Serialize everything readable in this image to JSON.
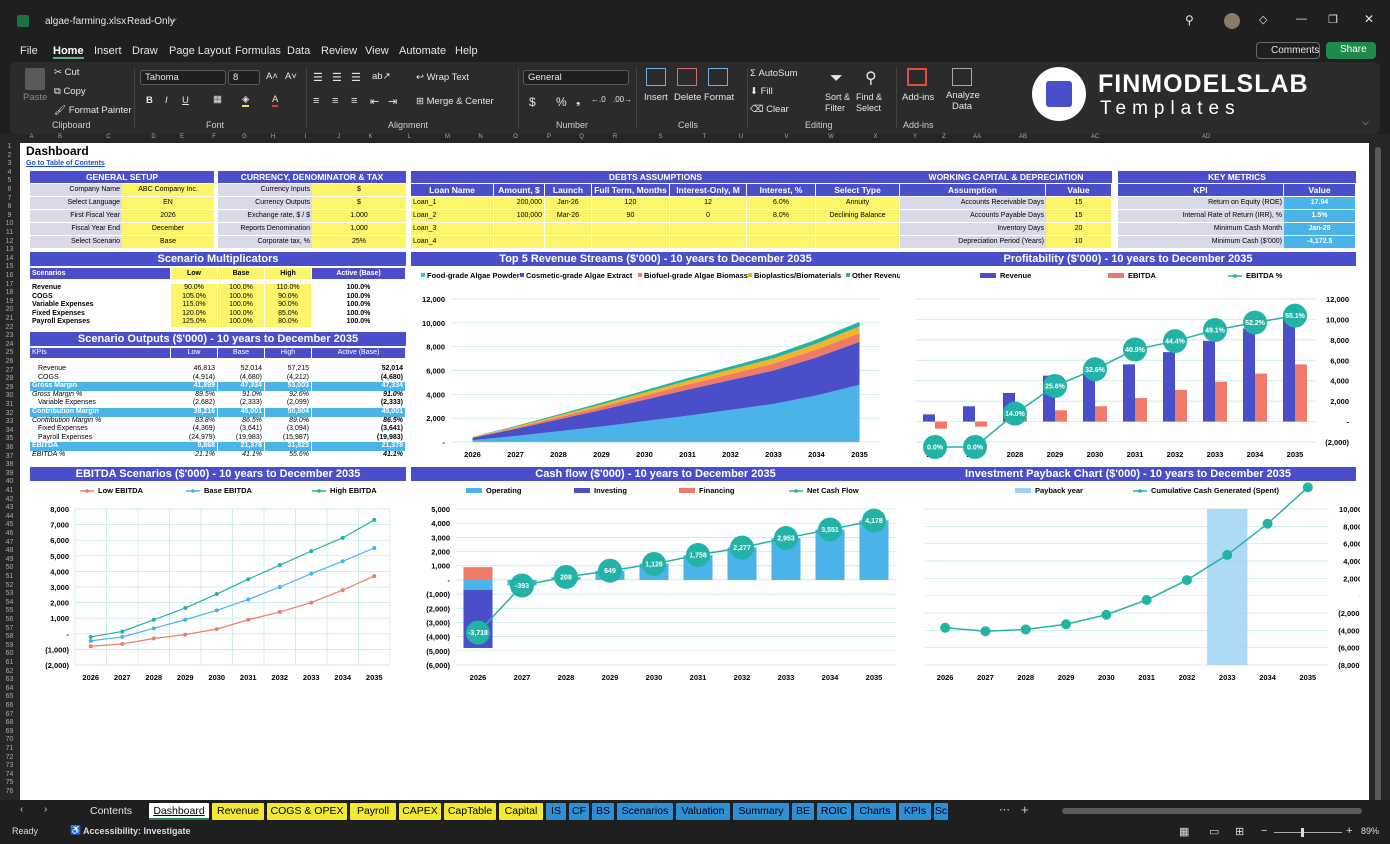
{
  "app": {
    "file_name": "algae-farming.xlsx",
    "mode": "Read-Only",
    "comments": "Comments",
    "share": "Share"
  },
  "menu": [
    "File",
    "Home",
    "Insert",
    "Draw",
    "Page Layout",
    "Formulas",
    "Data",
    "Review",
    "View",
    "Automate",
    "Help"
  ],
  "ribbon": {
    "clipboard": {
      "paste": "Paste",
      "cut": "Cut",
      "copy": "Copy",
      "format_painter": "Format Painter",
      "label": "Clipboard"
    },
    "font": {
      "name": "Tahoma",
      "size": "8",
      "label": "Font"
    },
    "alignment": {
      "wrap": "Wrap Text",
      "merge": "Merge & Center",
      "label": "Alignment"
    },
    "number": {
      "format": "General",
      "label": "Number"
    },
    "cells": {
      "insert": "Insert",
      "delete": "Delete",
      "format": "Format",
      "label": "Cells"
    },
    "editing": {
      "autosum": "AutoSum",
      "fill": "Fill",
      "clear": "Clear",
      "sort": "Sort & Filter",
      "find": "Find & Select",
      "label": "Editing"
    },
    "addins": {
      "addins": "Add-ins",
      "analyze": "Analyze Data",
      "label": "Add-ins"
    },
    "logo_title": "FINMODELSLAB",
    "logo_sub": "Templates"
  },
  "columns": [
    "A",
    "B",
    "C",
    "D",
    "E",
    "F",
    "G",
    "H",
    "I",
    "J",
    "K",
    "L",
    "M",
    "N",
    "O",
    "P",
    "Q",
    "R",
    "S",
    "T",
    "U",
    "V",
    "W",
    "X",
    "Y",
    "Z",
    "AA",
    "AB",
    "AC",
    "AD"
  ],
  "sheet": {
    "title": "Dashboard",
    "toc_link": "Go to Table of Contents",
    "general_setup": {
      "header": "GENERAL SETUP",
      "rows": [
        [
          "Company Name",
          "ABC Company Inc."
        ],
        [
          "Select Language",
          "EN"
        ],
        [
          "First Fiscal Year",
          "2026"
        ],
        [
          "Fiscal Year End",
          "December"
        ],
        [
          "Select Scenario",
          "Base"
        ]
      ]
    },
    "currency": {
      "header": "CURRENCY, DENOMINATOR & TAX",
      "rows": [
        [
          "Currency Inputs",
          "$"
        ],
        [
          "Currency Outputs",
          "$"
        ],
        [
          "Exchange rate, $ / $",
          "1.000"
        ],
        [
          "Reports Denomination",
          "1,000"
        ],
        [
          "Corporate tax, %",
          "25%"
        ]
      ]
    },
    "debts": {
      "header": "DEBTS ASSUMPTIONS",
      "cols": [
        "Loan Name",
        "Amount, $",
        "Launch",
        "Full Term, Months",
        "Interest-Only, M",
        "Interest, %",
        "Select Type"
      ],
      "rows": [
        [
          "Loan_1",
          "200,000",
          "Jan-26",
          "120",
          "12",
          "6.0%",
          "Annuity"
        ],
        [
          "Loan_2",
          "100,000",
          "Mar-26",
          "90",
          "0",
          "8.0%",
          "Declining Balance"
        ],
        [
          "Loan_3",
          "",
          "",
          "",
          "",
          "",
          ""
        ],
        [
          "Loan_4",
          "",
          "",
          "",
          "",
          "",
          ""
        ]
      ]
    },
    "working_capital": {
      "header": "WORKING CAPITAL & DEPRECIATION",
      "cols": [
        "Assumption",
        "Value"
      ],
      "rows": [
        [
          "Accounts Receivable Days",
          "15"
        ],
        [
          "Accounts Payable Days",
          "15"
        ],
        [
          "Inventory Days",
          "20"
        ],
        [
          "Depreciation Period (Years)",
          "10"
        ]
      ]
    },
    "key_metrics": {
      "header": "KEY METRICS",
      "cols": [
        "KPI",
        "Value"
      ],
      "rows": [
        [
          "Return on Equity (ROE)",
          "17.94"
        ],
        [
          "Internal Rate of Return (IRR), %",
          "1.5%"
        ],
        [
          "Minimum Cash Month",
          "Jan-28"
        ],
        [
          "Minimum Cash ($'000)",
          "-4,172.5"
        ]
      ]
    },
    "scenario_mult": {
      "header": "Scenario Multiplicators",
      "cols": [
        "Scenarios",
        "Low",
        "Base",
        "High",
        "Active (Base)"
      ],
      "rows": [
        [
          "Revenue",
          "90.0%",
          "100.0%",
          "110.0%",
          "100.0%"
        ],
        [
          "COGS",
          "105.0%",
          "100.0%",
          "90.0%",
          "100.0%"
        ],
        [
          "Variable Expenses",
          "115.0%",
          "100.0%",
          "90.0%",
          "100.0%"
        ],
        [
          "Fixed Expenses",
          "120.0%",
          "100.0%",
          "85.0%",
          "100.0%"
        ],
        [
          "Payroll Expenses",
          "125.0%",
          "100.0%",
          "80.0%",
          "100.0%"
        ]
      ]
    },
    "scenario_out": {
      "header": "Scenario Outputs ($'000) - 10 years to December 2035",
      "cols": [
        "KPIs",
        "Low",
        "Base",
        "High",
        "Active (Base)"
      ],
      "rows": [
        {
          "k": "Revenue",
          "v": [
            "46,813",
            "52,014",
            "57,215",
            "52,014"
          ],
          "s": "n"
        },
        {
          "k": "COGS",
          "v": [
            "(4,914)",
            "(4,680)",
            "(4,212)",
            "(4,680)"
          ],
          "s": "n"
        },
        {
          "k": "Gross Margin",
          "v": [
            "41,899",
            "47,334",
            "53,003",
            "47,334"
          ],
          "s": "h"
        },
        {
          "k": "Gross Margin %",
          "v": [
            "89.5%",
            "91.0%",
            "92.6%",
            "91.0%"
          ],
          "s": "i"
        },
        {
          "k": "Variable Expenses",
          "v": [
            "(2,682)",
            "(2,333)",
            "(2,099)",
            "(2,333)"
          ],
          "s": "n"
        },
        {
          "k": "Contribution Margin",
          "v": [
            "39,216",
            "45,001",
            "50,904",
            "45,001"
          ],
          "s": "h"
        },
        {
          "k": "Contribution Margin %",
          "v": [
            "83.8%",
            "86.5%",
            "89.0%",
            "86.5%"
          ],
          "s": "i"
        },
        {
          "k": "Fixed Expenses",
          "v": [
            "(4,369)",
            "(3,641)",
            "(3,094)",
            "(3,641)"
          ],
          "s": "n"
        },
        {
          "k": "Payroll Expenses",
          "v": [
            "(24,979)",
            "(19,983)",
            "(15,987)",
            "(19,983)"
          ],
          "s": "n"
        },
        {
          "k": "EBITDA",
          "v": [
            "9,868",
            "21,378",
            "31,823",
            "21,378"
          ],
          "s": "h"
        },
        {
          "k": "EBITDA %",
          "v": [
            "21.1%",
            "41.1%",
            "55.6%",
            "41.1%"
          ],
          "s": "i"
        }
      ]
    }
  },
  "chart_data": [
    {
      "type": "area",
      "title": "Top 5 Revenue Streams ($'000) - 10 years to December 2035",
      "categories": [
        "2026",
        "2027",
        "2028",
        "2029",
        "2030",
        "2031",
        "2032",
        "2033",
        "2034",
        "2035"
      ],
      "ylim": [
        0,
        12000
      ],
      "yticks": [
        "12,000",
        "10,000",
        "8,000",
        "6,000",
        "4,000",
        "2,000",
        "-"
      ],
      "series": [
        {
          "name": "Food-grade Algae Powder",
          "color": "#4ab3e8",
          "values": [
            150,
            500,
            900,
            1300,
            1750,
            2200,
            2700,
            3200,
            3900,
            4800
          ]
        },
        {
          "name": "Cosmetic-grade Algae Extract",
          "color": "#4a4fc9",
          "values": [
            200,
            600,
            1000,
            1400,
            1800,
            2200,
            2500,
            2800,
            3200,
            3600
          ]
        },
        {
          "name": "Biofuel-grade Algae Biomass",
          "color": "#f07a6a",
          "values": [
            40,
            100,
            180,
            260,
            340,
            420,
            500,
            580,
            660,
            740
          ]
        },
        {
          "name": "Bioplastics/Biomaterials",
          "color": "#f2b52a",
          "values": [
            30,
            80,
            140,
            200,
            260,
            320,
            380,
            440,
            500,
            560
          ]
        },
        {
          "name": "Other Revenue",
          "color": "#22b3a6",
          "values": [
            20,
            60,
            100,
            140,
            180,
            220,
            260,
            300,
            340,
            380
          ]
        }
      ]
    },
    {
      "type": "bar",
      "title": "Profitability ($'000) - 10 years to December 2035",
      "categories": [
        "2026",
        "2027",
        "2028",
        "2029",
        "2030",
        "2031",
        "2032",
        "2033",
        "2034",
        "2035"
      ],
      "ylim": [
        -2000,
        12000
      ],
      "yticks": [
        "12,000",
        "10,000",
        "8,000",
        "6,000",
        "4,000",
        "2,000",
        "-",
        "(2,000)"
      ],
      "series": [
        {
          "name": "Revenue",
          "color": "#4a4fc9",
          "values": [
            700,
            1500,
            2800,
            4500,
            4800,
            5600,
            6800,
            7900,
            9100,
            10200
          ]
        },
        {
          "name": "EBITDA",
          "color": "#f07a6a",
          "values": [
            -700,
            -500,
            400,
            1100,
            1500,
            2300,
            3100,
            3900,
            4700,
            5600
          ]
        },
        {
          "name": "EBITDA %",
          "color": "#22b3a6",
          "values": [
            0.0,
            0.0,
            14.0,
            25.6,
            32.6,
            40.9,
            44.4,
            49.1,
            52.2,
            55.1
          ],
          "labels": [
            "0.0%",
            "0.0%",
            "14.0%",
            "25.6%",
            "32.6%",
            "40.9%",
            "44.4%",
            "49.1%",
            "52.2%",
            "55.1%"
          ]
        }
      ]
    },
    {
      "type": "line",
      "title": "EBITDA Scenarios ($'000) - 10 years to December 2035",
      "categories": [
        "2026",
        "2027",
        "2028",
        "2029",
        "2030",
        "2031",
        "2032",
        "2033",
        "2034",
        "2035"
      ],
      "ylim": [
        -2000,
        8000
      ],
      "yticks": [
        "8,000",
        "7,000",
        "6,000",
        "5,000",
        "4,000",
        "3,000",
        "2,000",
        "1,000",
        "-",
        "(1,000)",
        "(2,000)"
      ],
      "series": [
        {
          "name": "Low EBITDA",
          "color": "#f07a6a",
          "values": [
            -800,
            -650,
            -300,
            -50,
            300,
            900,
            1400,
            2000,
            2800,
            3700
          ]
        },
        {
          "name": "Base EBITDA",
          "color": "#4ab3e8",
          "values": [
            -450,
            -200,
            350,
            900,
            1500,
            2200,
            3000,
            3850,
            4650,
            5500
          ]
        },
        {
          "name": "High EBITDA",
          "color": "#22b3a6",
          "values": [
            -200,
            150,
            900,
            1650,
            2550,
            3500,
            4400,
            5300,
            6150,
            7300
          ]
        }
      ]
    },
    {
      "type": "bar",
      "title": "Cash flow ($'000) - 10 years to December 2035",
      "categories": [
        "2026",
        "2027",
        "2028",
        "2029",
        "2030",
        "2031",
        "2032",
        "2033",
        "2034",
        "2035"
      ],
      "ylim": [
        -6000,
        5000
      ],
      "yticks": [
        "5,000",
        "4,000",
        "3,000",
        "2,000",
        "1,000",
        "-",
        "(1,000)",
        "(2,000)",
        "(3,000)",
        "(4,000)",
        "(5,000)",
        "(6,000)"
      ],
      "series": [
        {
          "name": "Operating",
          "color": "#4ab3e8",
          "values": [
            -700,
            -400,
            200,
            650,
            1150,
            1750,
            2300,
            2950,
            3550,
            4200
          ]
        },
        {
          "name": "Investing",
          "color": "#4a4fc9",
          "values": [
            -4100,
            0,
            0,
            0,
            0,
            0,
            0,
            0,
            0,
            0
          ]
        },
        {
          "name": "Financing",
          "color": "#f07a6a",
          "values": [
            900,
            0,
            0,
            0,
            0,
            0,
            0,
            0,
            0,
            0
          ]
        },
        {
          "name": "Net Cash Flow",
          "color": "#22b3a6",
          "values": [
            -3718,
            -393,
            208,
            649,
            1126,
            1758,
            2277,
            2953,
            3551,
            4178
          ],
          "labels": [
            "-3,718",
            "-393",
            "208",
            "649",
            "1,126",
            "1,758",
            "2,277",
            "2,953",
            "3,551",
            "4,178"
          ]
        }
      ]
    },
    {
      "type": "line",
      "title": "Investment Payback Chart ($'000) - 10 years to December 2035",
      "categories": [
        "2026",
        "2027",
        "2028",
        "2029",
        "2030",
        "2031",
        "2032",
        "2033",
        "2034",
        "2035"
      ],
      "ylim": [
        -8000,
        10000
      ],
      "yticks": [
        "10,000",
        "8,000",
        "6,000",
        "4,000",
        "2,000",
        "-",
        "(2,000)",
        "(4,000)",
        "(6,000)",
        "(8,000)"
      ],
      "series": [
        {
          "name": "Payback year",
          "color": "#9fd3f2",
          "values": [
            0,
            0,
            0,
            0,
            0,
            0,
            0,
            1,
            0,
            0
          ]
        },
        {
          "name": "Cumulative Cash Generated (Spent)",
          "color": "#22b3a6",
          "values": [
            -3700,
            -4100,
            -3900,
            -3300,
            -2200,
            -500,
            1800,
            4700,
            8300,
            12500
          ]
        }
      ]
    }
  ],
  "tabs": [
    {
      "n": "Contents",
      "c": "w"
    },
    {
      "n": "Dashboard",
      "c": "a"
    },
    {
      "n": "Revenue",
      "c": "y"
    },
    {
      "n": "COGS & OPEX",
      "c": "y"
    },
    {
      "n": "Payroll",
      "c": "y"
    },
    {
      "n": "CAPEX",
      "c": "y"
    },
    {
      "n": "CapTable",
      "c": "y"
    },
    {
      "n": "Capital",
      "c": "y"
    },
    {
      "n": "IS",
      "c": "b"
    },
    {
      "n": "CF",
      "c": "b"
    },
    {
      "n": "BS",
      "c": "b"
    },
    {
      "n": "Scenarios",
      "c": "b"
    },
    {
      "n": "Valuation",
      "c": "b"
    },
    {
      "n": "Summary",
      "c": "b"
    },
    {
      "n": "BE",
      "c": "b"
    },
    {
      "n": "ROIC",
      "c": "b"
    },
    {
      "n": "Charts",
      "c": "b"
    },
    {
      "n": "KPIs",
      "c": "b"
    },
    {
      "n": "Sc",
      "c": "b"
    }
  ],
  "status": {
    "ready": "Ready",
    "accessibility": "Accessibility: Investigate",
    "zoom": "89%"
  }
}
